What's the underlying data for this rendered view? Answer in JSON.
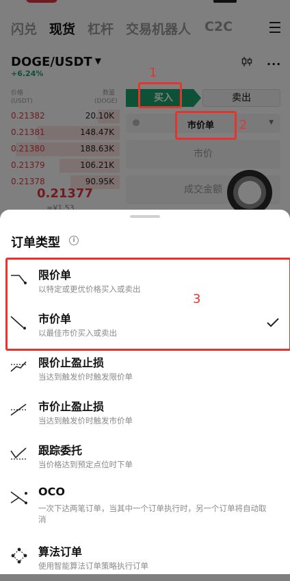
{
  "nav": {
    "tabs": [
      "闪兑",
      "现货",
      "杠杆",
      "交易机器人",
      "C2C"
    ],
    "active": "现货"
  },
  "pair": {
    "symbol": "DOGE/USDT",
    "change": "+6.24%"
  },
  "orderbook": {
    "price_header": [
      "价格",
      "(USDT)"
    ],
    "qty_header": [
      "数量",
      "(DOGE)"
    ],
    "rows": [
      {
        "price": "0.21382",
        "qty": "20.10K",
        "depth": 0.2
      },
      {
        "price": "0.21381",
        "qty": "148.47K",
        "depth": 0.75
      },
      {
        "price": "0.21380",
        "qty": "188.63K",
        "depth": 0.95
      },
      {
        "price": "0.21379",
        "qty": "106.21K",
        "depth": 0.55
      },
      {
        "price": "0.21378",
        "qty": "90.95K",
        "depth": 0.45
      }
    ],
    "last_price": "0.21377",
    "fiat_price": "≈¥1.53"
  },
  "trade": {
    "buy_label": "买入",
    "sell_label": "卖出",
    "order_type": "市价单",
    "price_field": "市价",
    "amount_field": "成交金额"
  },
  "annotations": [
    "1",
    "2",
    "3"
  ],
  "sheet": {
    "title": "订单类型",
    "options": [
      {
        "name": "限价单",
        "desc": "以特定或更优价格买入或卖出",
        "icon": "limit-order-icon",
        "selected": false
      },
      {
        "name": "市价单",
        "desc": "以最佳市价买入或卖出",
        "icon": "market-order-icon",
        "selected": true
      },
      {
        "name": "限价止盈止损",
        "desc": "当达到触发价时触发限价单",
        "icon": "limit-tpsl-icon",
        "selected": false
      },
      {
        "name": "市价止盈止损",
        "desc": "当达到触发价时触发市价单",
        "icon": "market-tpsl-icon",
        "selected": false
      },
      {
        "name": "跟踪委托",
        "desc": "当价格达到预定点位时下单",
        "icon": "trailing-order-icon",
        "selected": false
      },
      {
        "name": "OCO",
        "desc": "一次下达两笔订单，当其中一个订单执行时，另一个订单将自动取消",
        "icon": "oco-icon",
        "selected": false
      },
      {
        "name": "算法订单",
        "desc": "使用智能算法订单策略执行订单",
        "icon": "algo-order-icon",
        "selected": false
      }
    ]
  },
  "colors": {
    "buy": "#1aa36d",
    "sell": "#e0373f",
    "annotation": "#e8322c"
  }
}
